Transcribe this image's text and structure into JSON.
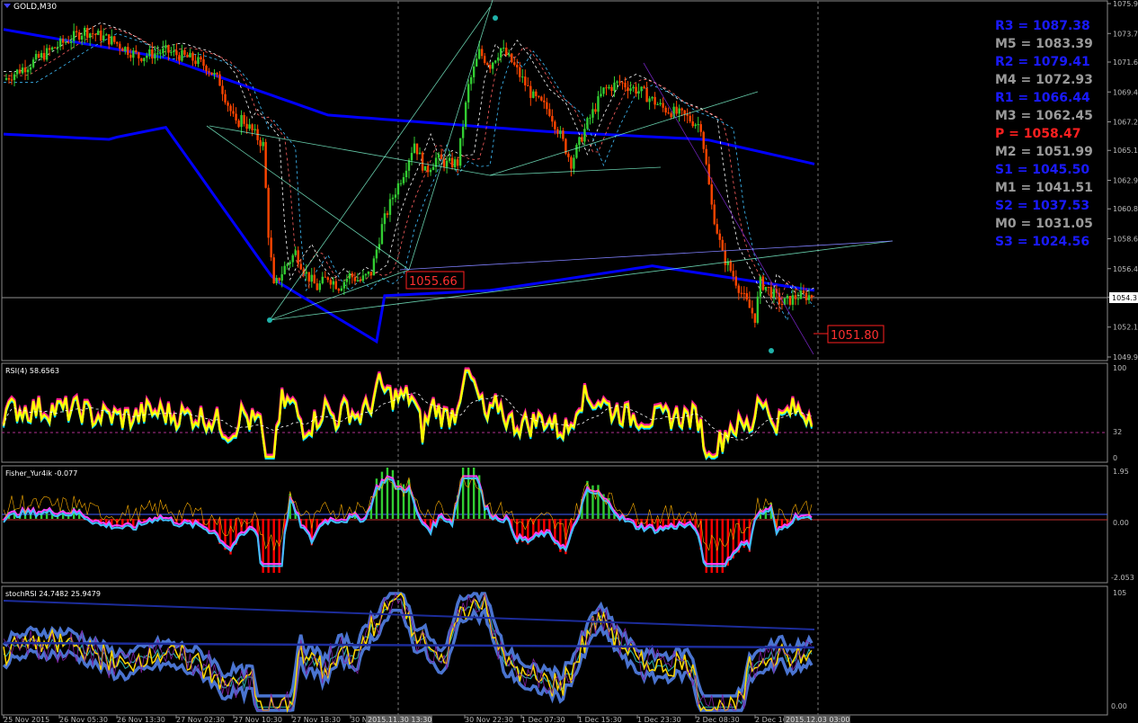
{
  "window": {
    "symbol_title": "GOLD,M30"
  },
  "panels": {
    "rsi": {
      "label": "RSI(4) 58.6563",
      "levels": [
        "100",
        "32",
        "0"
      ]
    },
    "fisher": {
      "label": "Fisher_Yur4ik -0.077",
      "levels": [
        "1.95",
        "0.00",
        "-2.053"
      ]
    },
    "stoch": {
      "label": "stochRSI 24.7482 25.9479",
      "levels": [
        "105",
        "0.00"
      ]
    }
  },
  "price_axis": {
    "ticks": [
      "1075.9",
      "1073.7",
      "1071.6",
      "1069.4",
      "1067.2",
      "1065.1",
      "1062.9",
      "1060.8",
      "1058.6",
      "1056.4",
      "1054.3",
      "1052.1",
      "1049.9"
    ],
    "current_price": "1054.3"
  },
  "price_labels": {
    "mid_label": "1055.66",
    "low_label": "1051.80"
  },
  "pivots": [
    {
      "label": "R3 = 1087.38",
      "color": "#1a1aff"
    },
    {
      "label": "M5 = 1083.39",
      "color": "#9a9a9a"
    },
    {
      "label": "R2 = 1079.41",
      "color": "#1a1aff"
    },
    {
      "label": "M4 = 1072.93",
      "color": "#9a9a9a"
    },
    {
      "label": "R1 = 1066.44",
      "color": "#1a1aff"
    },
    {
      "label": "M3 = 1062.45",
      "color": "#9a9a9a"
    },
    {
      "label": "P   = 1058.47",
      "color": "#ff2020"
    },
    {
      "label": "M2 = 1051.99",
      "color": "#9a9a9a"
    },
    {
      "label": "S1 = 1045.50",
      "color": "#1a1aff"
    },
    {
      "label": "M1 = 1041.51",
      "color": "#9a9a9a"
    },
    {
      "label": "S2 = 1037.53",
      "color": "#1a1aff"
    },
    {
      "label": "M0 = 1031.05",
      "color": "#9a9a9a"
    },
    {
      "label": "S3 = 1024.56",
      "color": "#1a1aff"
    }
  ],
  "time_axis": {
    "labels": [
      "25 Nov 2015",
      "26 Nov 05:30",
      "26 Nov 13:30",
      "27 Nov 02:30",
      "27 Nov 10:30",
      "27 Nov 18:30",
      "30 Nov 10:30",
      "30 Nov 22:30",
      "1 Dec 07:30",
      "1 Dec 15:30",
      "1 Dec 23:30",
      "2 Dec 08:30",
      "2 Dec 16:30"
    ],
    "highlight_labels": [
      "2015.11.30 13:30",
      "2015.12.03 03:00"
    ]
  },
  "colors": {
    "background": "#000000",
    "bull": "#32cd32",
    "bear": "#ff4500",
    "ma_slow": "#0000ff",
    "rsi_main": "#ffff00",
    "hist_up": "#32cd32",
    "hist_down": "#ff0000"
  },
  "chart_data": {
    "type": "candlestick",
    "title": "GOLD,M30",
    "ylim": [
      1049.9,
      1075.9
    ],
    "x_start": "25 Nov 2015",
    "x_end": "2015.12.03 03:00",
    "close_path": [
      [
        0,
        1070.3
      ],
      [
        10,
        1071.5
      ],
      [
        20,
        1072.8
      ],
      [
        30,
        1073.9
      ],
      [
        40,
        1073.2
      ],
      [
        50,
        1072.0
      ],
      [
        60,
        1072.4
      ],
      [
        70,
        1071.8
      ],
      [
        75,
        1071.3
      ],
      [
        80,
        1070.1
      ],
      [
        84,
        1068.0
      ],
      [
        86,
        1066.9
      ],
      [
        88,
        1067.5
      ],
      [
        92,
        1066.5
      ],
      [
        96,
        1065.5
      ],
      [
        98,
        1059.0
      ],
      [
        100,
        1055.0
      ],
      [
        104,
        1056.5
      ],
      [
        108,
        1057.6
      ],
      [
        112,
        1056.0
      ],
      [
        116,
        1055.0
      ],
      [
        120,
        1055.8
      ],
      [
        124,
        1055.1
      ],
      [
        128,
        1055.9
      ],
      [
        132,
        1055.5
      ],
      [
        136,
        1056.1
      ],
      [
        140,
        1059.5
      ],
      [
        144,
        1061.7
      ],
      [
        148,
        1063.5
      ],
      [
        152,
        1065.7
      ],
      [
        156,
        1063.5
      ],
      [
        160,
        1064.5
      ],
      [
        164,
        1064.1
      ],
      [
        168,
        1064.2
      ],
      [
        172,
        1069.8
      ],
      [
        176,
        1072.3
      ],
      [
        180,
        1071.4
      ],
      [
        184,
        1072.6
      ],
      [
        188,
        1071.6
      ],
      [
        196,
        1069.0
      ],
      [
        202,
        1068.0
      ],
      [
        206,
        1066.2
      ],
      [
        210,
        1064.2
      ],
      [
        216,
        1067.1
      ],
      [
        222,
        1069.5
      ],
      [
        228,
        1070.1
      ],
      [
        236,
        1069.4
      ],
      [
        244,
        1068.2
      ],
      [
        252,
        1067.6
      ],
      [
        258,
        1066.9
      ],
      [
        262,
        1061.0
      ],
      [
        266,
        1057.4
      ],
      [
        270,
        1055.9
      ],
      [
        274,
        1054.2
      ],
      [
        278,
        1052.8
      ],
      [
        280,
        1055.4
      ],
      [
        284,
        1054.7
      ],
      [
        288,
        1053.8
      ],
      [
        294,
        1054.4
      ]
    ]
  }
}
